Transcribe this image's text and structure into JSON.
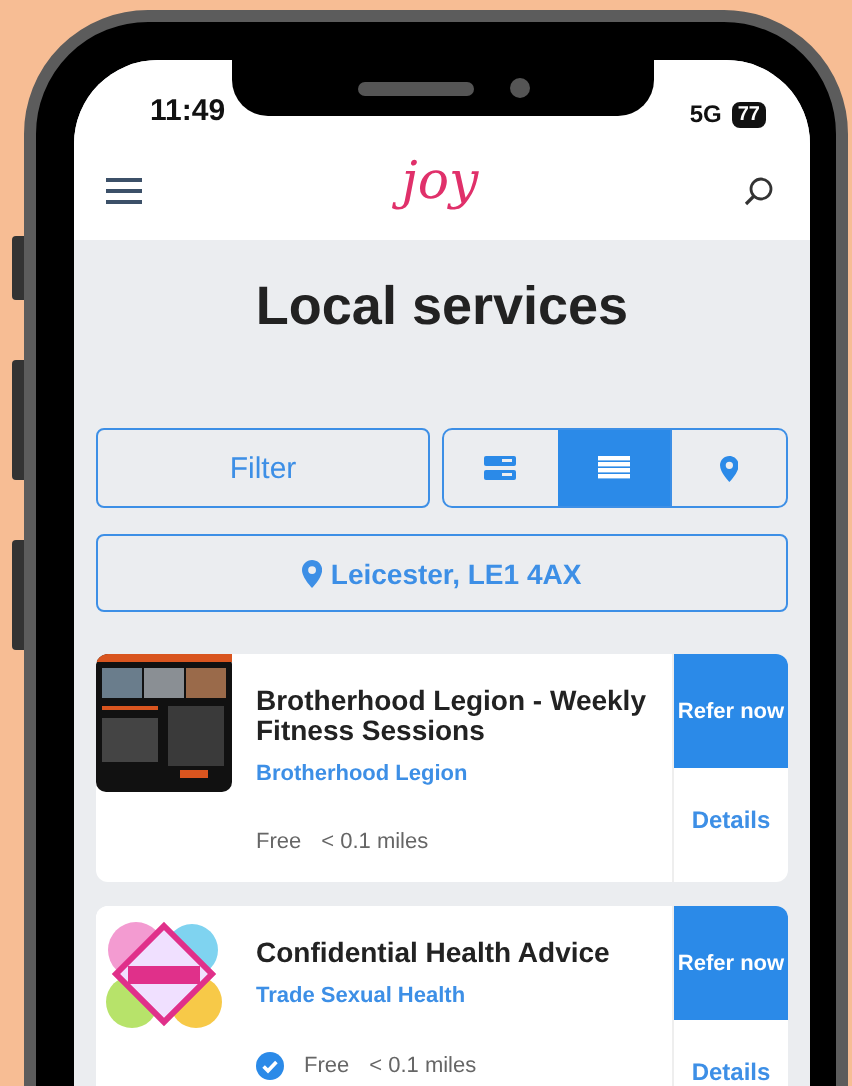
{
  "status_bar": {
    "time": "11:49",
    "network": "5G",
    "battery": "77"
  },
  "header": {
    "logo": "joy"
  },
  "page_title": "Local services",
  "filter_button": "Filter",
  "view_options": [
    {
      "kind": "cards",
      "selected": false
    },
    {
      "kind": "list",
      "selected": true
    },
    {
      "kind": "map",
      "selected": false
    }
  ],
  "location_button": "Leicester, LE1 4AX",
  "services": [
    {
      "title": "Brotherhood Legion - Weekly Fitness Sessions",
      "provider": "Brotherhood Legion",
      "price": "Free",
      "distance": "< 0.1 miles",
      "verified": false,
      "refer_button": "Refer now",
      "details_link": "Details"
    },
    {
      "title": "Confidential Health Advice",
      "provider": "Trade Sexual Health",
      "price": "Free",
      "distance": "< 0.1 miles",
      "verified": true,
      "refer_button": "Refer now",
      "details_link": "Details"
    }
  ]
}
